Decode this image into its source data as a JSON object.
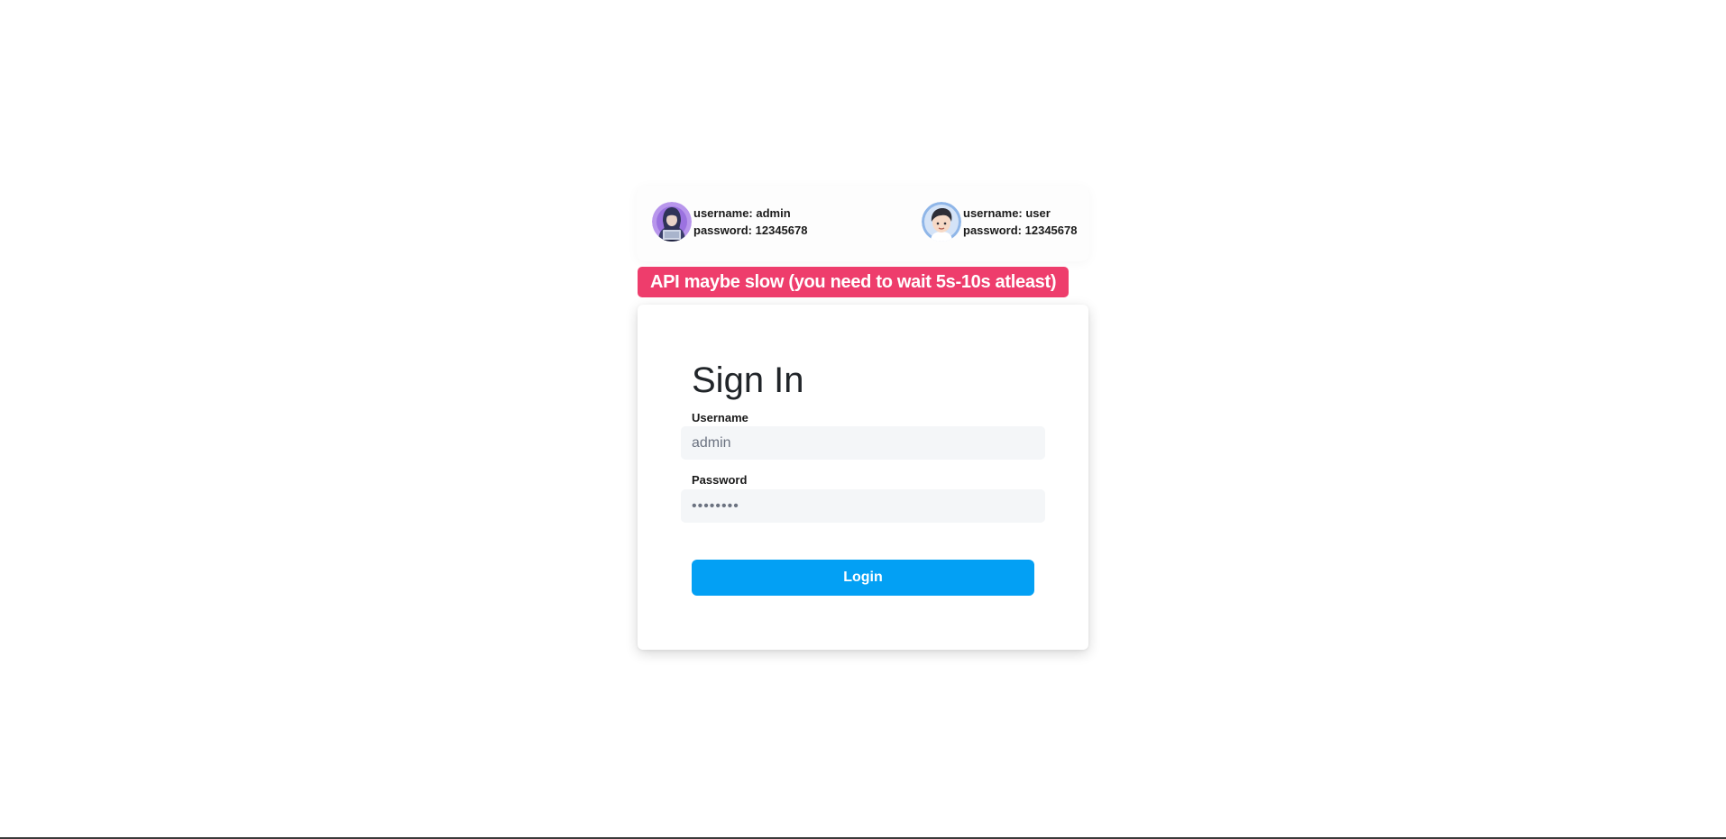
{
  "credentials": [
    {
      "role": "admin",
      "username_line": "username: admin",
      "password_line": "password: 12345678",
      "avatar_icon": "hacker-avatar-icon"
    },
    {
      "role": "user",
      "username_line": "username: user",
      "password_line": "password: 12345678",
      "avatar_icon": "user-avatar-icon"
    }
  ],
  "warning": {
    "text": "API maybe slow (you need to wait 5s-10s atleast)",
    "color": "#ee3d6c"
  },
  "login": {
    "title": "Sign In",
    "username_label": "Username",
    "username_value": "admin",
    "password_label": "Password",
    "password_value": "12345678",
    "submit_label": "Login",
    "accent_color": "#03a0f4"
  }
}
